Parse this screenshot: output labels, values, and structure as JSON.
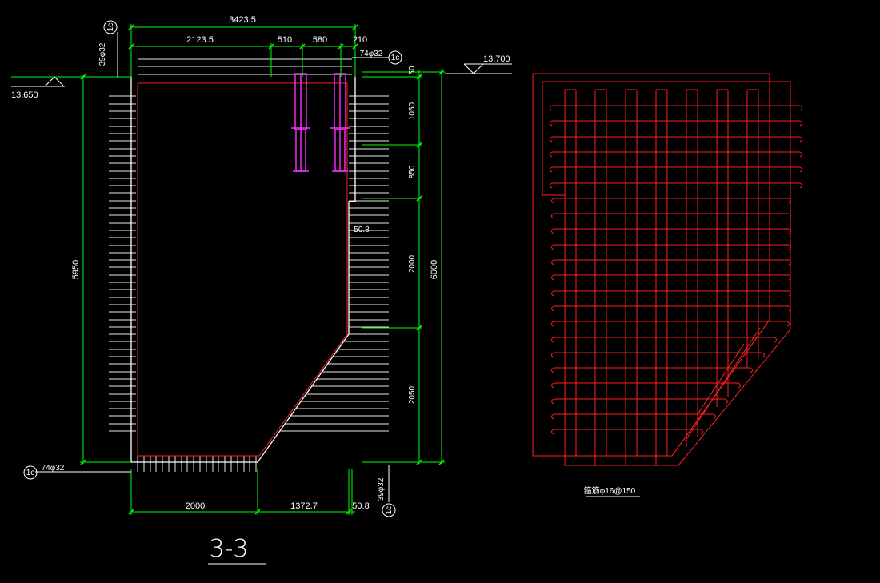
{
  "drawing": {
    "section_title": "3-3",
    "level_right": "13.700",
    "level_left": "13.650",
    "top_overall": "3423.5",
    "top_dims": [
      "2123.5",
      "510",
      "580",
      "210"
    ],
    "bottom_dims": [
      "2000",
      "1372.7",
      "50.8"
    ],
    "left_height": "5950",
    "right_overall": "6000",
    "right_dims": [
      "50",
      "1050",
      "850",
      "2000",
      "2050"
    ],
    "inner_dim": "50.8",
    "rebar_labels": {
      "top_left_vertical": "39φ32",
      "top_right": "74φ32",
      "bottom_left": "74φ32",
      "bottom_right_vertical": "39φ32"
    },
    "axis_bubbles": [
      "1c",
      "1c",
      "1c",
      "1c"
    ],
    "detail_caption": "箍筋φ16@150"
  },
  "colors": {
    "background": "#000000",
    "dimension": "#00ff00",
    "rebar": "#ff0000",
    "outline": "#ffffff",
    "embed": "#ff00ff"
  }
}
